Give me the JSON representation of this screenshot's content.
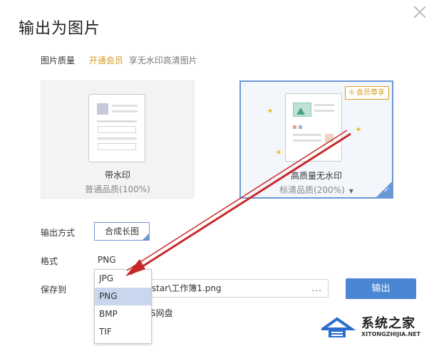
{
  "dialog": {
    "title": "输出为图片",
    "quality": {
      "label": "图片质量",
      "vip_link": "开通会员",
      "tip": "享无水印高清图片"
    },
    "cards": [
      {
        "name": "带水印",
        "sub": "普通品质(100%)"
      },
      {
        "name": "高质量无水印",
        "sub": "标清品质(200%)",
        "badge": "会员尊享"
      }
    ],
    "output_mode": {
      "label": "输出方式",
      "value": "合成长图"
    },
    "format": {
      "label": "格式",
      "value": "PNG",
      "options": [
        "JPG",
        "PNG",
        "BMP",
        "TIF"
      ],
      "selected": "PNG"
    },
    "save_to": {
      "label": "保存到",
      "path": "star\\工作簿1.png",
      "more": "...",
      "cloud": "S网盘"
    },
    "export_button": "输出"
  },
  "watermark": {
    "brand_cn": "系统之家",
    "brand_en": "XITONGZHIJIA.NET"
  },
  "colors": {
    "accent": "#4a86d4",
    "vip": "#d99a1e",
    "selected_border": "#6b98d6",
    "annotation_arrow": "#c8282a"
  }
}
